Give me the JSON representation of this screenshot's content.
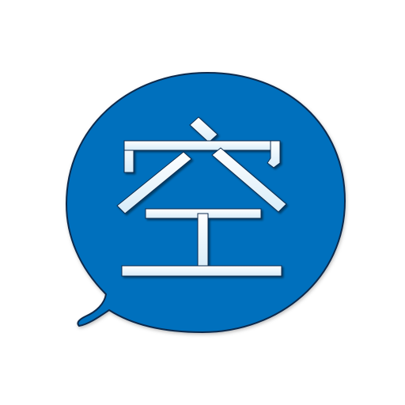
{
  "icon": {
    "name": "speech-bubble-icon",
    "glyph": "空",
    "colors": {
      "bubble_fill": "#0670bd",
      "bubble_outline": "#0a2c4e",
      "glyph_fill_top": "#ffffff",
      "glyph_fill_bottom": "#d7ecf9",
      "background": "#ffffff"
    }
  }
}
